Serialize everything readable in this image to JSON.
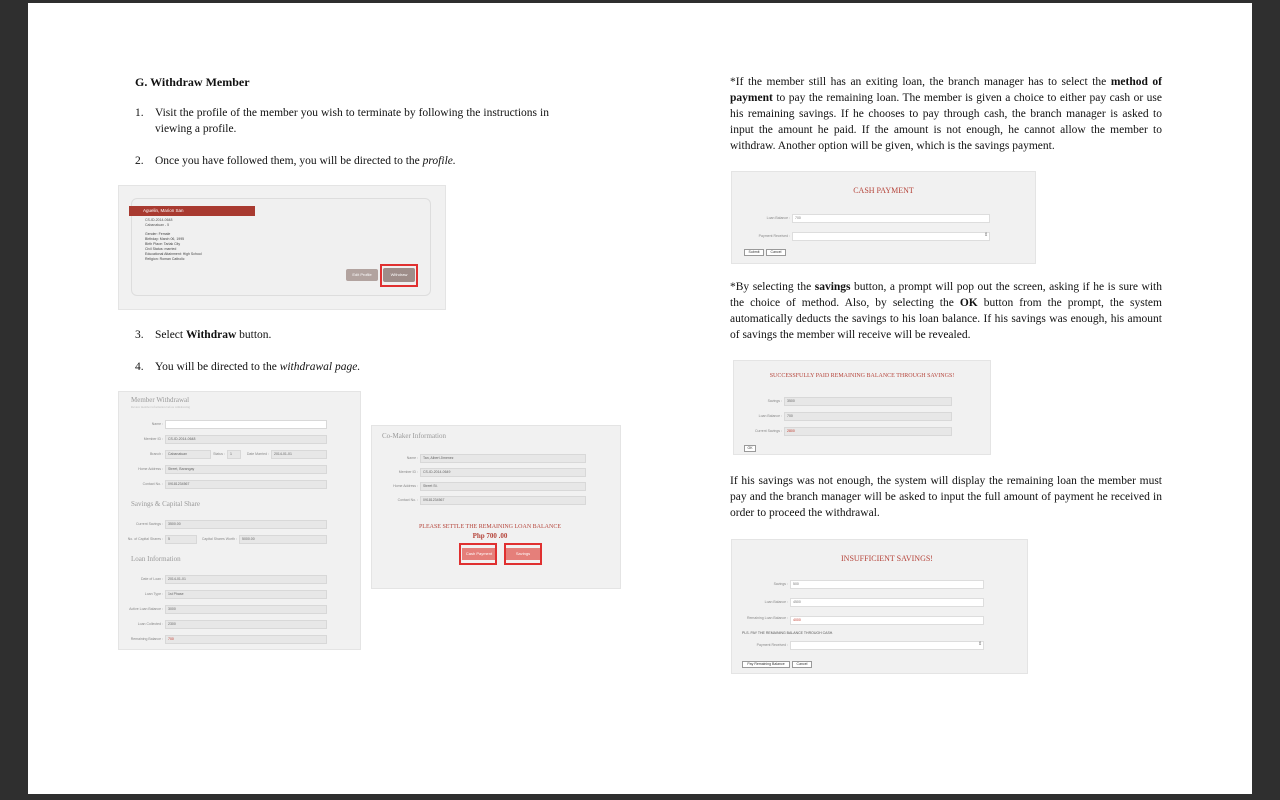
{
  "section_title": "G. Withdraw Member",
  "steps": [
    {
      "num": "1.",
      "text": "Visit the profile of the member you wish to terminate by following the instructions in viewing a profile."
    },
    {
      "num": "2.",
      "prefix": "Once you have followed them, you will be directed to the ",
      "em": "profile."
    },
    {
      "num": "3.",
      "prefix": "Select ",
      "strong": "Withdraw",
      "suffix": " button."
    },
    {
      "num": "4.",
      "prefix": "You will be directed to the ",
      "em": "withdrawal page."
    }
  ],
  "profile_shot": {
    "name": "Aguelin, Marion San",
    "id": "CS-ID-2014-0648",
    "sub": "Cabanatuan - 5",
    "details": [
      "Gender: Female",
      "Birthday: March 06, 1995",
      "Birth Place: Tarlak City",
      "Civil Status: married",
      "Educational Attainment: High School",
      "Religion: Roman Catholic"
    ],
    "edit_button": "Edit Profile",
    "withdraw_button": "Withdraw"
  },
  "withdrawal_shot": {
    "title": "Member Withdrawal",
    "subtitle": "Review member information before withdrawing",
    "member_rows": [
      {
        "label": "Name :",
        "value": ""
      },
      {
        "label": "Member ID :",
        "value": "CS-ID-2014-0648"
      },
      {
        "label": "Branch :",
        "value": "Cabanatuan"
      },
      {
        "label": "Home Address :",
        "value": "Street, Barangay"
      },
      {
        "label": "Contact No. :",
        "value": "09181234567"
      }
    ],
    "row3_extra": [
      {
        "label": "Status :",
        "value": "1"
      },
      {
        "label": "Date Married :",
        "value": "2014-01-01"
      }
    ],
    "savings_title": "Savings & Capital Share",
    "savings_rows": [
      {
        "label": "Current Savings :",
        "value": "3500.00"
      },
      {
        "label": "No. of Capital Shares :",
        "value": "5"
      }
    ],
    "capital_extra": {
      "label": "Capital Shares Worth :",
      "value": "5000.00"
    },
    "loan_title": "Loan Information",
    "loan_rows": [
      {
        "label": "Date of Loan :",
        "value": "2014-01-01"
      },
      {
        "label": "Loan Type :",
        "value": "1st Phase"
      },
      {
        "label": "Active Loan Balance :",
        "value": "3000"
      },
      {
        "label": "Loan Collected :",
        "value": "2300"
      },
      {
        "label": "Remaining Balance :",
        "value": "700"
      }
    ]
  },
  "comaker_shot": {
    "title": "Co-Maker Information",
    "rows": [
      {
        "label": "Name :",
        "value": "Tan, Albert Jimenez"
      },
      {
        "label": "Member ID :",
        "value": "CS-ID-2014-0649"
      },
      {
        "label": "Home Address :",
        "value": "Street St."
      },
      {
        "label": "Contact No. :",
        "value": "09181234567"
      }
    ],
    "notice": "PLEASE SETTLE THE REMAINING LOAN BALANCE",
    "amount": "Php 700 .00",
    "cash_button": "Cash Payment",
    "savings_button": "Savings"
  },
  "right_col": {
    "para1": {
      "p1": "*If the member still has an exiting loan, the branch manager has to select the ",
      "b1": "method of payment",
      "p2": " to pay the remaining loan. The member is given a choice to either pay cash or use his remaining savings. If he chooses to pay through cash, the branch manager is asked to input the amount he paid. If the amount is not enough, he cannot allow the member to withdraw. Another option will be given, which is the savings payment."
    },
    "cash_shot": {
      "title": "CASH PAYMENT",
      "rows": [
        {
          "label": "Loan Balance :",
          "value": "700"
        },
        {
          "label": "Payment Received :",
          "value": ""
        }
      ],
      "submit": "Submit",
      "cancel": "Cancel"
    },
    "para2": {
      "p1": "*By selecting the ",
      "b1": "savings",
      "p2": " button, a prompt will pop out the screen, asking if he is sure with the choice of method. Also, by selecting the ",
      "b2": "OK",
      "p3": " button from the prompt, the system automatically deducts the savings to his loan balance. If his savings was enough, his amount of savings the member will receive will be revealed."
    },
    "success_shot": {
      "title": "SUCCESSFULLY PAID REMAINING BALANCE THROUGH SAVINGS!",
      "rows": [
        {
          "label": "Savings :",
          "value": "3500"
        },
        {
          "label": "Loan Balance :",
          "value": "700"
        },
        {
          "label": "Current Savings :",
          "value": "2800"
        }
      ],
      "ok": "OK"
    },
    "para3": "If his savings was not enough, the system will display the remaining loan the member must pay and the branch manager will be asked to input the full amount of payment he received in order to proceed the withdrawal.",
    "insufficient_shot": {
      "title": "INSUFFICIENT SAVINGS!",
      "rows": [
        {
          "label": "Savings :",
          "value": "500"
        },
        {
          "label": "Loan Balance :",
          "value": "4500"
        },
        {
          "label": "Remaining Loan Balance :",
          "value": "4000"
        }
      ],
      "note": "PLS. PAY THE REMAINING BALANCE THROUGH CASH.",
      "payment_label": "Payment Received :",
      "pay_button": "Pay Remaining Balance",
      "cancel": "Cancel"
    }
  },
  "colors": {
    "accent_red": "#b5443a",
    "highlight_red": "#e03030",
    "page": "#ffffff",
    "background": "#2f2f2f"
  }
}
